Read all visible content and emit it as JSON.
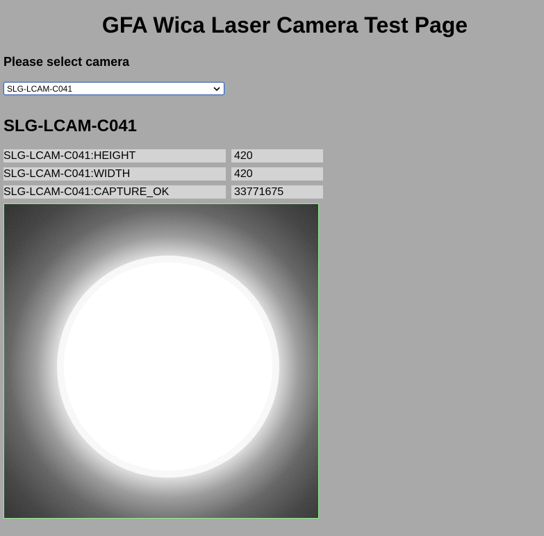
{
  "page": {
    "title": "GFA Wica Laser Camera Test Page"
  },
  "camera_selector": {
    "label": "Please select camera",
    "selected_value": "SLG-LCAM-C041",
    "icon": "chevron-down-icon"
  },
  "camera": {
    "heading": "SLG-LCAM-C041",
    "pvs": [
      {
        "name": "SLG-LCAM-C041:HEIGHT",
        "value": "420"
      },
      {
        "name": "SLG-LCAM-C041:WIDTH",
        "value": "420"
      },
      {
        "name": "SLG-LCAM-C041:CAPTURE_OK",
        "value": "33771675"
      }
    ]
  },
  "colors": {
    "page_background": "#a9a9a9",
    "field_background": "#d3d3d3",
    "image_border": "#90ee90"
  }
}
